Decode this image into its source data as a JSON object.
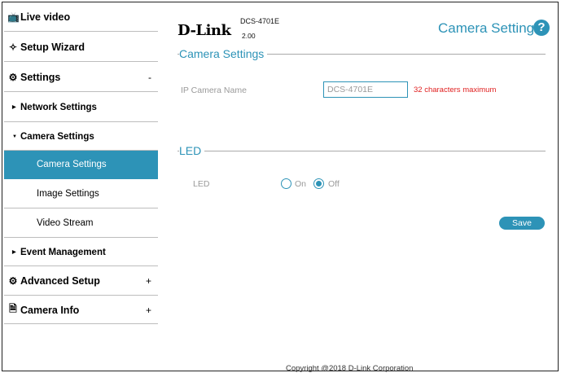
{
  "sidebar": {
    "items": [
      {
        "label": "Live video",
        "icon": "video-icon",
        "marker": ""
      },
      {
        "label": "Setup Wizard",
        "icon": "wand-icon",
        "marker": ""
      },
      {
        "label": "Settings",
        "icon": "gear-icon",
        "marker": "-"
      },
      {
        "label": "Network Settings",
        "icon": "triangle-right-icon",
        "marker": ""
      },
      {
        "label": "Camera Settings",
        "icon": "triangle-down-icon",
        "marker": ""
      },
      {
        "label": "Camera Settings",
        "icon": "",
        "marker": ""
      },
      {
        "label": "Image Settings",
        "icon": "",
        "marker": ""
      },
      {
        "label": "Video Stream",
        "icon": "",
        "marker": ""
      },
      {
        "label": "Event Management",
        "icon": "triangle-right-icon",
        "marker": ""
      },
      {
        "label": "Advanced Setup",
        "icon": "gears-icon",
        "marker": "+"
      },
      {
        "label": "Camera Info",
        "icon": "document-icon",
        "marker": "+"
      }
    ]
  },
  "header": {
    "logo": "D-Link",
    "model": "DCS-4701E",
    "version": "2.00",
    "page_title": "Camera Settings",
    "help": "?"
  },
  "camera_section": {
    "title": "Camera Settings",
    "name_label": "IP Camera Name",
    "name_value": "DCS-4701E",
    "name_hint": "32 characters maximum"
  },
  "led_section": {
    "title": "LED",
    "label": "LED",
    "on_label": "On",
    "off_label": "Off",
    "selected": "Off"
  },
  "save_label": "Save",
  "footer": "Copyright @2018 D-Link Corporation",
  "colors": {
    "accent": "#2d93b7",
    "hint": "#e02020"
  }
}
